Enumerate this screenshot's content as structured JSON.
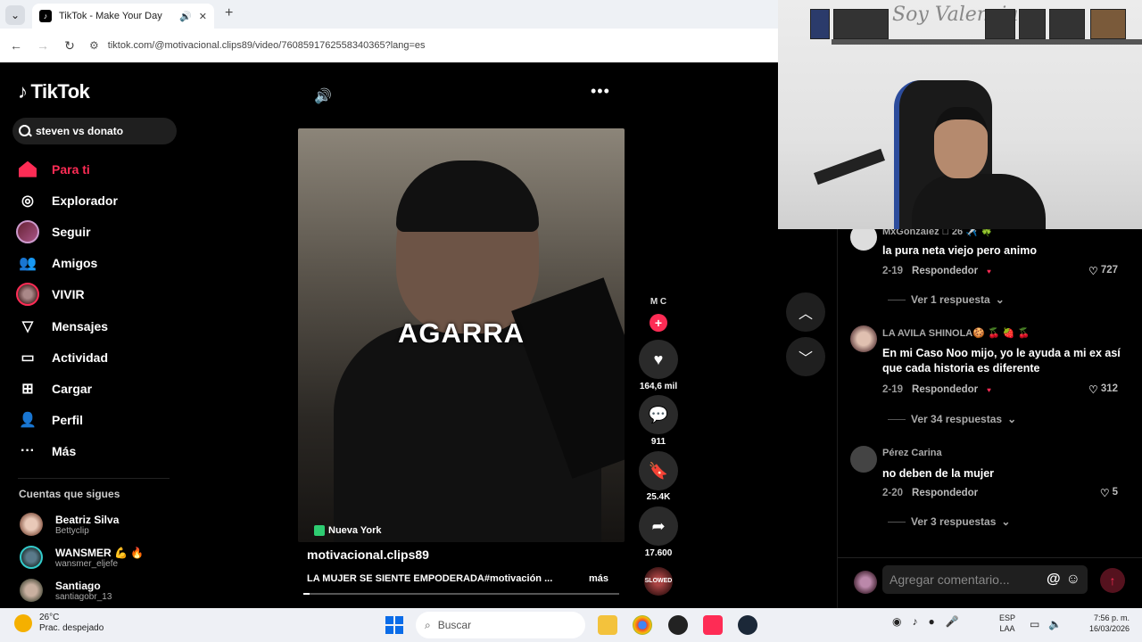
{
  "browser": {
    "tab_title": "TikTok - Make Your Day",
    "url": "tiktok.com/@motivacional.clips89/video/7608591762558340365?lang=es"
  },
  "sidebar": {
    "logo": "TikTok",
    "search_value": "steven vs donato",
    "items": [
      {
        "label": "Para ti",
        "icon": "home-icon"
      },
      {
        "label": "Explorador",
        "icon": "compass-icon"
      },
      {
        "label": "Seguir",
        "icon": "following-avatar-icon"
      },
      {
        "label": "Amigos",
        "icon": "friends-icon"
      },
      {
        "label": "VIVIR",
        "icon": "live-avatar-icon"
      },
      {
        "label": "Mensajes",
        "icon": "send-icon"
      },
      {
        "label": "Actividad",
        "icon": "activity-icon"
      },
      {
        "label": "Cargar",
        "icon": "upload-icon"
      },
      {
        "label": "Perfil",
        "icon": "profile-avatar-icon"
      },
      {
        "label": "Más",
        "icon": "more-dots-icon"
      }
    ],
    "following_title": "Cuentas que sigues",
    "following": [
      {
        "name": "Beatriz Silva",
        "handle": "Bettyclip"
      },
      {
        "name": "WANSMER 💪 🔥",
        "handle": "wansmer_eljefe"
      },
      {
        "name": "Santiago",
        "handle": "santiagobr_13"
      }
    ]
  },
  "video": {
    "overlay_text": "AGARRA",
    "location": "Nueva York",
    "author": "motivacional.clips89",
    "description": "LA MUJER SE SIENTE EMPODERADA#motivación ...",
    "more": "más",
    "creator_badge": "M C",
    "music_label": "SLOWED",
    "progress": 0.02
  },
  "actions": {
    "likes": "164,6 mil",
    "comments": "911",
    "saves": "25.4K",
    "shares": "17.600"
  },
  "comments": [
    {
      "name": "MxGonzalez 🏻 26 ✈️ 🍀",
      "text": "la pura neta viejo pero animo",
      "date": "2-19",
      "reply": "Respondedor",
      "likes": "727",
      "replies": "Ver 1 respuesta"
    },
    {
      "name": "LA AVILA SHINOLA🍪 🍒 🍓 🍒",
      "text": "En mi Caso Noo mijo, yo le ayuda a mi ex así que cada historia es diferente",
      "date": "2-19",
      "reply": "Respondedor",
      "likes": "312",
      "replies": "Ver 34 respuestas"
    },
    {
      "name": "Pérez Carina",
      "text": "no deben de la mujer",
      "date": "2-20",
      "reply": "Respondedor",
      "likes": "5",
      "replies": "Ver 3 respuestas"
    }
  ],
  "comment_input": {
    "placeholder": "Agregar comentario..."
  },
  "webcam": {
    "sign": "Soy Valencia"
  },
  "taskbar": {
    "temp": "26°C",
    "weather": "Prac. despejado",
    "search": "Buscar",
    "lang": "ESP",
    "lang2": "LAA",
    "time": "7:56 p. m.",
    "date": "16/03/2026"
  }
}
